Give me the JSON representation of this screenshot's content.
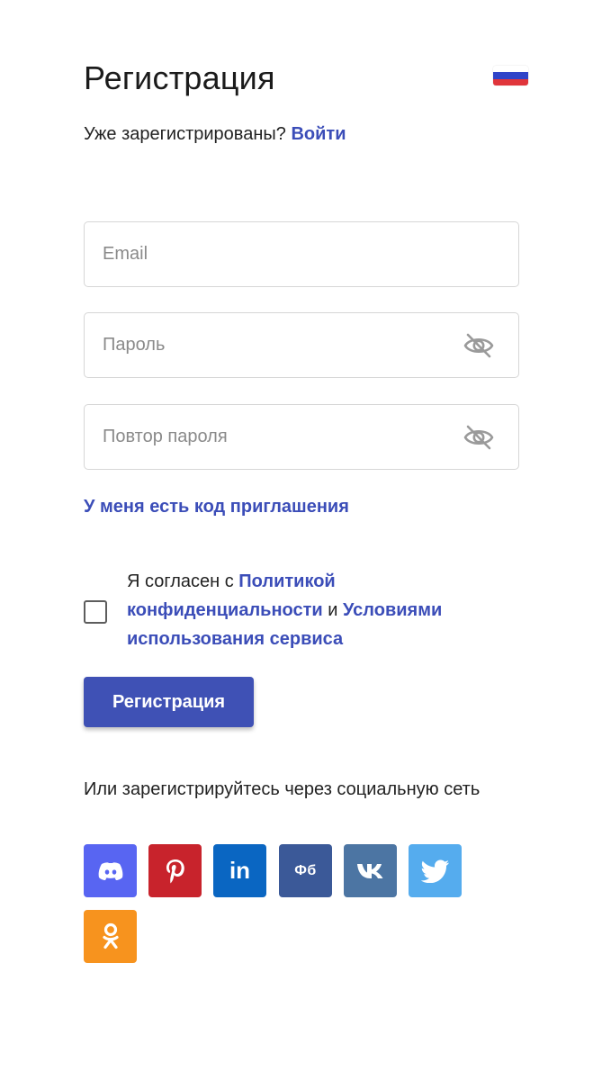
{
  "header": {
    "title": "Регистрация",
    "language_flag": "russian-flag-icon"
  },
  "login": {
    "prompt": "Уже зарегистрированы?",
    "link": "Войти"
  },
  "form": {
    "email_placeholder": "Email",
    "email_value": "",
    "password_placeholder": "Пароль",
    "password_value": "",
    "repeat_placeholder": "Повтор пароля",
    "repeat_value": ""
  },
  "invite_link": "У меня есть код приглашения",
  "agreement": {
    "text_1": "Я согласен с ",
    "link_1": "Политикой конфиденциальности",
    "text_2": " и ",
    "link_2": "Условиями использования сервиса",
    "checked": false
  },
  "register_button": "Регистрация",
  "social": {
    "label": "Или зарегистрируйтесь через социальную сеть",
    "networks": [
      {
        "name": "discord",
        "icon": "discord-icon",
        "color": "#5865f2"
      },
      {
        "name": "pinterest",
        "icon": "pinterest-icon",
        "color": "#c8232c"
      },
      {
        "name": "linkedin",
        "icon": "linkedin-icon",
        "color": "#0a66c2"
      },
      {
        "name": "facebook",
        "icon": "facebook-icon",
        "color": "#3b5998",
        "label": "Фб"
      },
      {
        "name": "vk",
        "icon": "vk-icon",
        "color": "#4c75a3"
      },
      {
        "name": "twitter",
        "icon": "twitter-icon",
        "color": "#55acee"
      },
      {
        "name": "odnoklassniki",
        "icon": "odnoklassniki-icon",
        "color": "#f7931e"
      }
    ]
  },
  "colors": {
    "accent": "#3f51b5",
    "link": "#3b4db8",
    "border": "#d6d6d6"
  }
}
